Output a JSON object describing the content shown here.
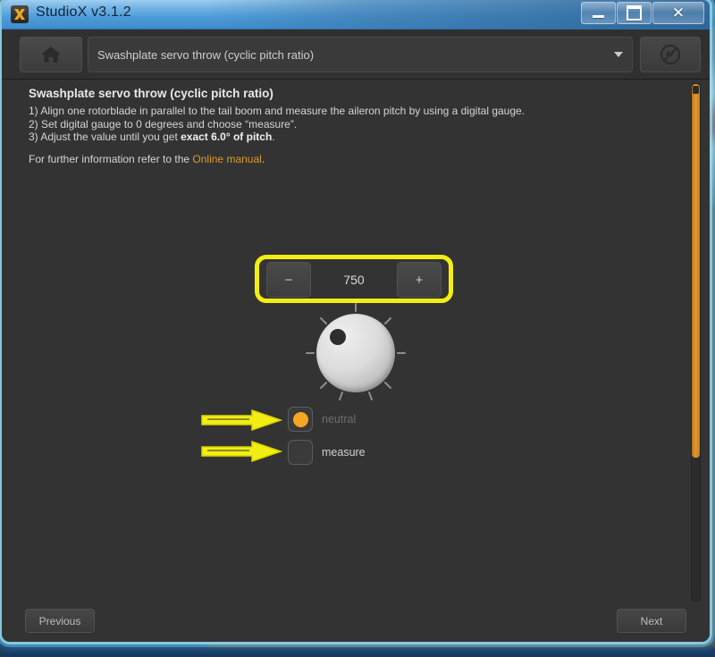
{
  "window": {
    "app_title": "StudioX v3.1.2",
    "app_icon": "x-logo-icon",
    "minimize_icon": "minimize-icon",
    "maximize_icon": "maximize-icon",
    "close_icon": "close-icon"
  },
  "toolbar": {
    "home_icon": "home-icon",
    "dropdown_value": "Swashplate servo throw (cyclic pitch ratio)",
    "dropdown_arrow_icon": "chevron-down-icon",
    "connection_icon": "no-connection-icon"
  },
  "panel": {
    "title": "Swashplate servo throw (cyclic pitch ratio)",
    "step1": "1) Align one rotorblade in parallel to the tail boom and measure the aileron pitch by using a digital gauge.",
    "step2": "2) Set digital gauge to 0 degrees and choose “measure”.",
    "step3_pre": "3) Adjust the value until you get ",
    "step3_bold": "exact 6.0°  of pitch",
    "step3_post": ".",
    "note_pre": "For further information refer to the ",
    "note_link": "Online manual",
    "note_post": "."
  },
  "stepper": {
    "minus_label": "−",
    "value": "750",
    "plus_label": "+"
  },
  "knob": {
    "name": "rotary-knob"
  },
  "options": [
    {
      "label": "neutral",
      "selected": true
    },
    {
      "label": "measure",
      "selected": false
    }
  ],
  "scrollbar": {
    "name": "vertical-scrollbar"
  },
  "footer": {
    "previous_label": "Previous",
    "next_label": "Next"
  },
  "colors": {
    "highlight_yellow": "#f2ee12",
    "accent_orange": "#f5a623",
    "scrollbar_orange": "#e2982f",
    "link_orange": "#d99a2b",
    "window_glow": "#96dcf0"
  }
}
